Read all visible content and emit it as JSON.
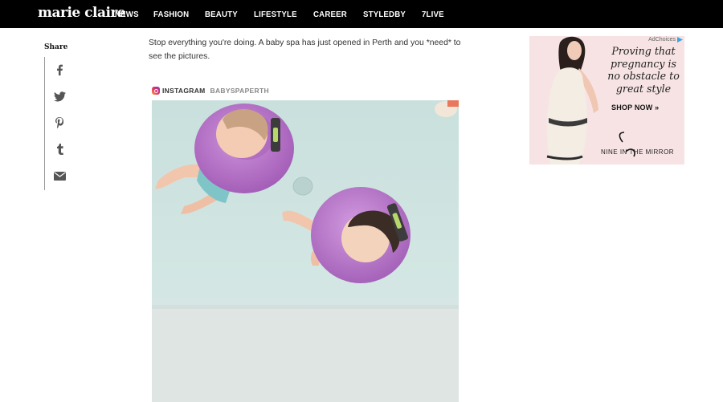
{
  "header": {
    "logo": "marie claire",
    "nav": [
      "NEWS",
      "FASHION",
      "BEAUTY",
      "LIFESTYLE",
      "CAREER",
      "STYLEDBY",
      "7LIVE"
    ]
  },
  "share": {
    "title": "Share",
    "icons": [
      "facebook-icon",
      "twitter-icon",
      "pinterest-icon",
      "tumblr-icon",
      "email-icon"
    ]
  },
  "article": {
    "intro": "Stop everything you're doing. A baby spa has just opened in Perth and you *need* to see the pictures."
  },
  "instagram": {
    "label": "INSTAGRAM",
    "username": "BABYSPAPERTH"
  },
  "ad": {
    "choices": "AdChoices",
    "headline": "Proving that pregnancy is no obstacle to great style",
    "cta": "SHOP NOW »",
    "brand": "NINE IN THE MIRROR"
  },
  "colors": {
    "nav_bg": "#000000",
    "ad_bg": "#f7e3e4",
    "pool_water": "#cfe3e1",
    "float_ring": "#b66fc4"
  }
}
